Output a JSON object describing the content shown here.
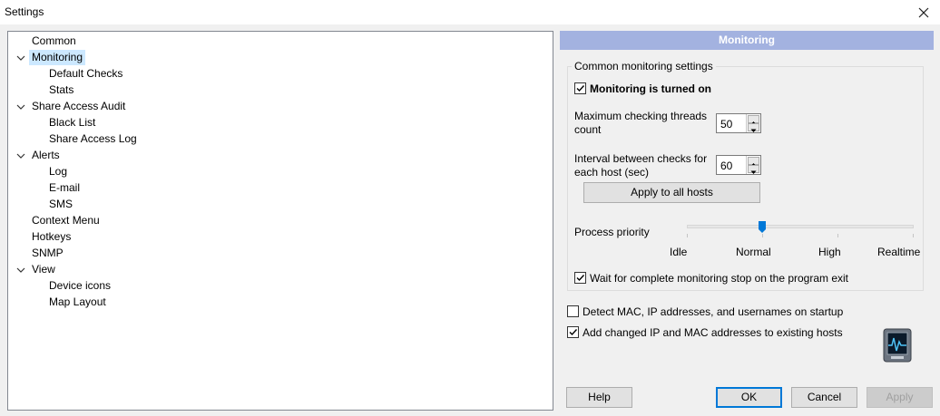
{
  "window": {
    "title": "Settings"
  },
  "tree": {
    "items": [
      {
        "label": "Common"
      },
      {
        "label": "Monitoring"
      },
      {
        "label": "Default Checks"
      },
      {
        "label": "Stats"
      },
      {
        "label": "Share Access Audit"
      },
      {
        "label": "Black List"
      },
      {
        "label": "Share Access Log"
      },
      {
        "label": "Alerts"
      },
      {
        "label": "Log"
      },
      {
        "label": "E-mail"
      },
      {
        "label": "SMS"
      },
      {
        "label": "Context Menu"
      },
      {
        "label": "Hotkeys"
      },
      {
        "label": "SNMP"
      },
      {
        "label": "View"
      },
      {
        "label": "Device icons"
      },
      {
        "label": "Map Layout"
      }
    ],
    "selected": "Monitoring"
  },
  "panel": {
    "header": "Monitoring",
    "group_label": "Common monitoring settings",
    "monitoring_on": {
      "label": "Monitoring is turned on",
      "checked": true
    },
    "max_threads": {
      "label_line1": "Maximum checking threads",
      "label_line2": "count",
      "value": "50"
    },
    "interval": {
      "label_line1": "Interval between checks for",
      "label_line2": "each host (sec)",
      "value": "60"
    },
    "apply_all_label": "Apply to all hosts",
    "priority": {
      "label": "Process priority",
      "levels": [
        "Idle",
        "Normal",
        "High",
        "Realtime"
      ],
      "selected": "Normal"
    },
    "wait_stop": {
      "label": "Wait for complete monitoring stop on the program exit",
      "checked": true
    },
    "detect_mac": {
      "label": "Detect MAC, IP addresses, and usernames on startup",
      "checked": false
    },
    "add_changed": {
      "label": "Add changed IP and MAC addresses to existing hosts",
      "checked": true
    }
  },
  "buttons": {
    "help": "Help",
    "ok": "OK",
    "cancel": "Cancel",
    "apply": "Apply"
  },
  "icons": {
    "close": "close-icon",
    "expander": "chevron-down-icon",
    "check": "checkmark-icon",
    "app": "monitor-app-icon"
  },
  "colors": {
    "header_bg": "#a3b2e0",
    "selection": "#cce8ff",
    "accent": "#0078d7"
  }
}
